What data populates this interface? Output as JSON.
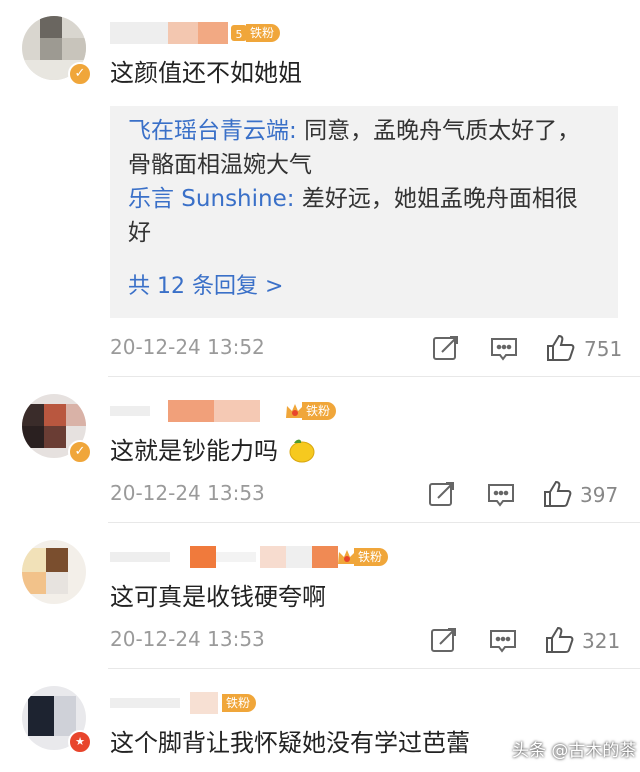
{
  "comments": [
    {
      "name_badge": "铁粉",
      "badge_level": "5",
      "text": "这颜值还不如她姐",
      "replies": [
        {
          "name": "飞在瑶台青云端",
          "sep": ": ",
          "text": "同意，孟晚舟气质太好了，骨骼面相温婉大气"
        },
        {
          "name": "乐言 Sunshine",
          "sep": ": ",
          "text": "差好远，她姐孟晚舟面相很好"
        }
      ],
      "more_replies": "共 12 条回复 >",
      "time": "20-12-24 13:52",
      "likes": "751"
    },
    {
      "name_badge": "铁粉",
      "text": "这就是钞能力吗",
      "emoji": "lemon-emoji",
      "time": "20-12-24 13:53",
      "likes": "397"
    },
    {
      "name_badge": "铁粉",
      "text": "这可真是收钱硬夸啊",
      "time": "20-12-24 13:53",
      "likes": "321"
    },
    {
      "name_badge": "铁粉",
      "text": "这个脚背让我怀疑她没有学过芭蕾"
    }
  ],
  "watermark": "头条 @古木的茶",
  "colors": {
    "link": "#3a70c8",
    "badge": "#f0a63a",
    "verify_gold": "#f0a63a",
    "verify_red": "#e8452c"
  },
  "icons": [
    "share-icon",
    "comment-icon",
    "like-icon",
    "verified-icon",
    "crown-icon"
  ]
}
